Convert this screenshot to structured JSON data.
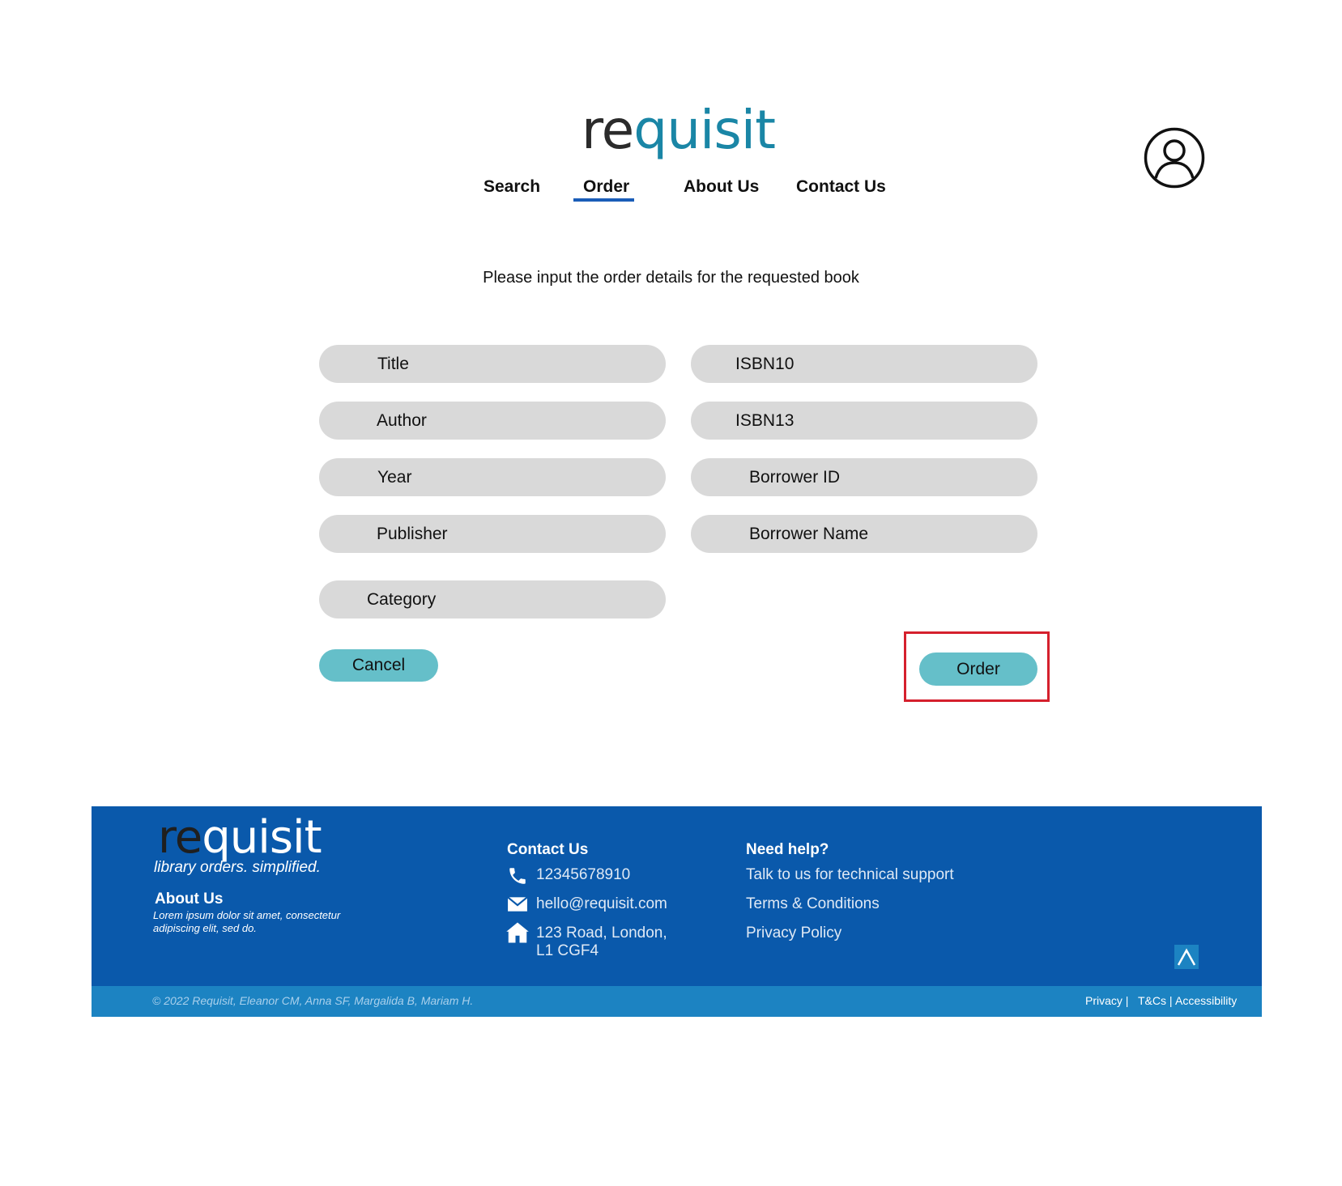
{
  "header": {
    "logo": {
      "part1": "re",
      "part2": "q",
      "part3": "uisit"
    },
    "nav": [
      {
        "label": "Search"
      },
      {
        "label": "Order",
        "active": true
      },
      {
        "label": "About Us"
      },
      {
        "label": "Contact Us"
      }
    ],
    "avatar_icon": "user-circle-icon"
  },
  "form": {
    "intro": "Please input the order details for the requested book",
    "fields": {
      "title": "Title",
      "author": "Author",
      "year": "Year",
      "publisher": "Publisher",
      "category": "Category",
      "isbn10": "ISBN10",
      "isbn13": "ISBN13",
      "borrower_id": "Borrower ID",
      "borrower_name": "Borrower Name"
    },
    "cancel_label": "Cancel",
    "order_label": "Order"
  },
  "footer": {
    "logo": {
      "part1": "re",
      "part2": "q",
      "part3": "uisit"
    },
    "tagline": "library orders. simplified.",
    "about_heading": "About Us",
    "about_text_1": "Lorem ipsum dolor sit amet, consectetur",
    "about_text_2": "adipiscing elit, sed do.",
    "contact_heading": "Contact Us",
    "phone": "12345678910",
    "email": "hello@requisit.com",
    "address_1": "123 Road, London,",
    "address_2": "L1 CGF4",
    "help_heading": "Need help?",
    "help_links": [
      "Talk to us for technical support",
      "Terms & Conditions",
      "Privacy Policy"
    ],
    "copyright": "© 2022 Requisit, Eleanor CM, Anna SF, Margalida B, Mariam H.",
    "bottom_links": {
      "privacy": "Privacy |",
      "tcs": "T&Cs |",
      "accessibility": "Accessibility"
    }
  },
  "colors": {
    "accent_button": "#65bfc9",
    "footer_blue": "#0a59ab",
    "footer_bar": "#1c83c2",
    "highlight": "#d5202d",
    "logo_teal": "#1a86a6"
  }
}
